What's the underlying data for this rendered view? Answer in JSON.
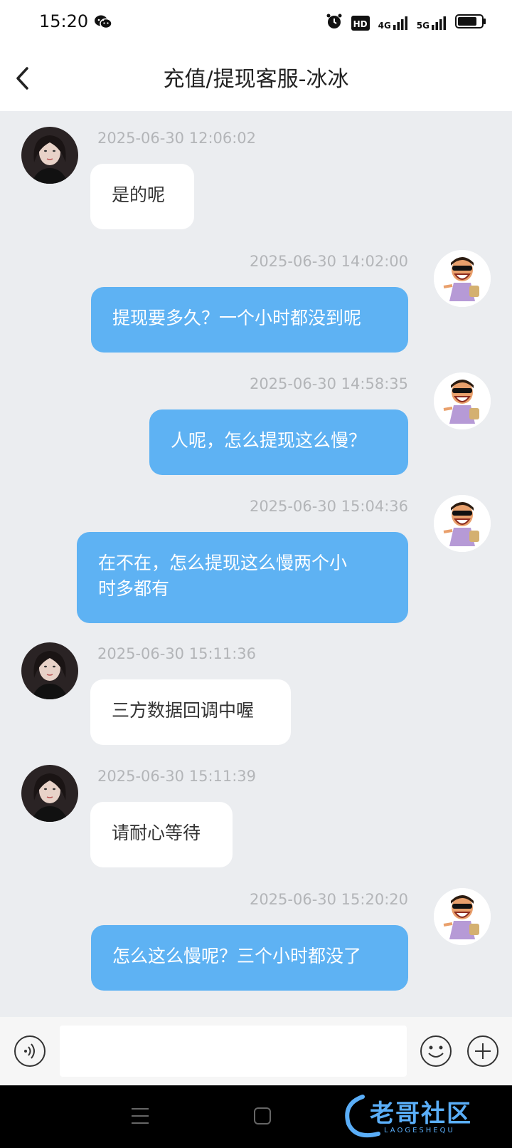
{
  "status": {
    "time": "15:20",
    "network_1": "4G",
    "network_2": "5G",
    "hd_label": "HD",
    "icons": [
      "wechat-icon",
      "alarm-icon",
      "hd-icon",
      "signal-icon",
      "battery-icon"
    ]
  },
  "header": {
    "title": "充值/提现客服-冰冰",
    "back_icon": "chevron-left-icon"
  },
  "messages": [
    {
      "sender": "agent",
      "timestamp": "2025-06-30 12:06:02",
      "lines": [
        "是的呢"
      ]
    },
    {
      "sender": "user",
      "timestamp": "2025-06-30 14:02:00",
      "lines": [
        "提现要多久？一个小时都没到呢"
      ]
    },
    {
      "sender": "user",
      "timestamp": "2025-06-30 14:58:35",
      "lines": [
        "人呢，怎么提现这么慢？"
      ]
    },
    {
      "sender": "user",
      "timestamp": "2025-06-30 15:04:36",
      "lines": [
        "在不在，怎么提现这么慢两个小",
        "时多都有"
      ]
    },
    {
      "sender": "agent",
      "timestamp": "2025-06-30 15:11:36",
      "lines": [
        "三方数据回调中喔"
      ]
    },
    {
      "sender": "agent",
      "timestamp": "2025-06-30 15:11:39",
      "lines": [
        "请耐心等待"
      ]
    },
    {
      "sender": "user",
      "timestamp": "2025-06-30 15:20:20",
      "lines": [
        "怎么这么慢呢？三个小时都没了"
      ]
    }
  ],
  "input": {
    "value": "",
    "placeholder": "",
    "voice_icon": "voice-icon",
    "emoji_icon": "emoji-icon",
    "plus_icon": "plus-icon"
  },
  "watermark": {
    "text": "老哥社区",
    "sub": "LAOGESHEQU"
  },
  "colors": {
    "background": "#ebedf0",
    "outgoing_bubble": "#5eb2f3",
    "incoming_bubble": "#ffffff",
    "timestamp": "#b3b5b8"
  }
}
